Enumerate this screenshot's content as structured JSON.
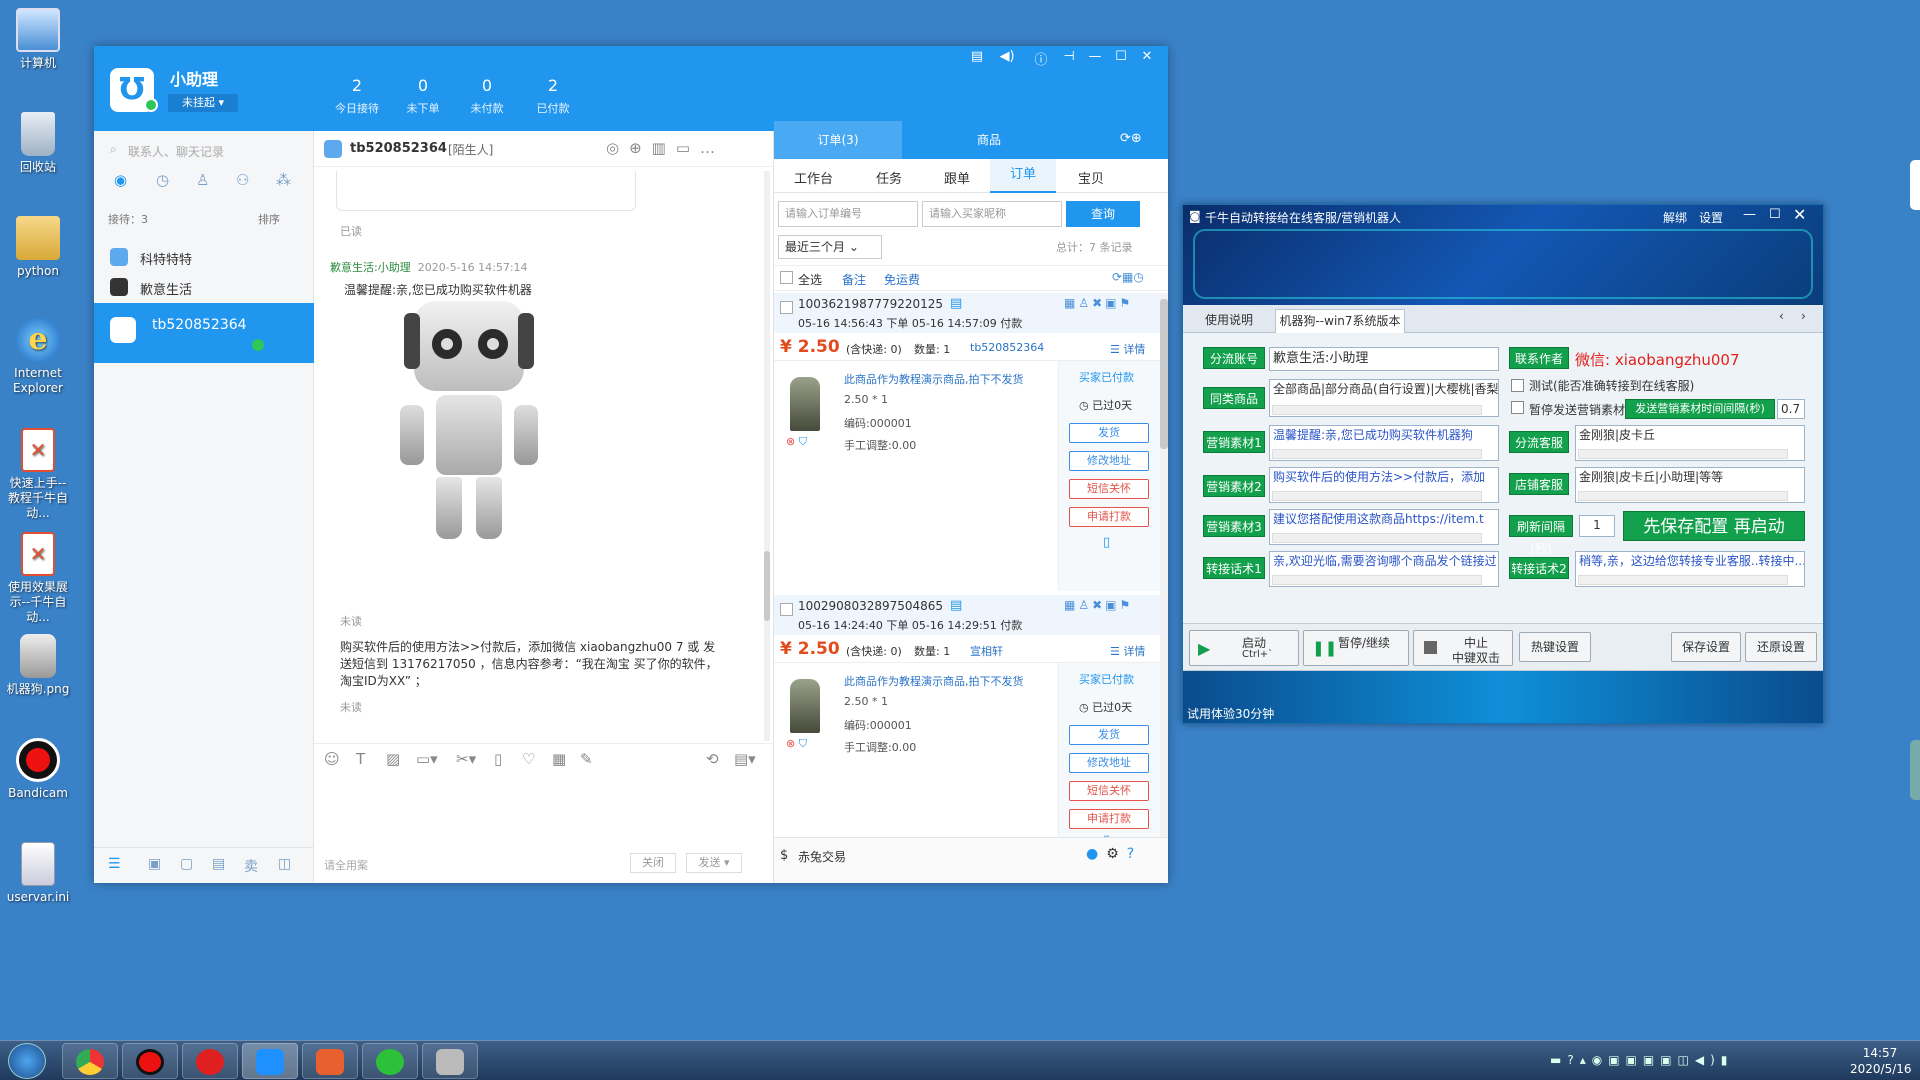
{
  "desktop": {
    "icons": [
      "计算机",
      "回收站",
      "python",
      "Internet Explorer",
      "快速上手--教程千牛自动...",
      "使用效果展示--千牛自动...",
      "机器狗.png",
      "Bandicam",
      "uservar.ini"
    ]
  },
  "taskbar": {
    "time": "14:57",
    "date": "2020/5/16",
    "apps": [
      "start-orb",
      "chrome",
      "bandicam",
      "netease-music",
      "qianniu",
      "wps",
      "wechat",
      "robot"
    ]
  },
  "qianniu": {
    "user": {
      "name": "小助理",
      "status": "未挂起 ▾"
    },
    "stats": [
      {
        "value": "2",
        "label": "今日接待"
      },
      {
        "value": "0",
        "label": "未下单"
      },
      {
        "value": "0",
        "label": "未付款"
      },
      {
        "value": "2",
        "label": "已付款"
      }
    ],
    "search_placeholder": "联系人、聊天记录",
    "reception_count": "接待：3",
    "sort_label": "排序",
    "contacts": [
      "科特特特",
      "歉意生活",
      "tb520852364"
    ],
    "chat": {
      "contact": "tb520852364",
      "contact_tag": "[陌生人]",
      "read_label": "已读",
      "sender": "歉意生活:小助理",
      "timestamp": "2020-5-16 14:57:14",
      "message1": "温馨提醒:亲,您已成功购买软件机器",
      "unread_label": "未读",
      "message2": "购买软件后的使用方法>>付款后，添加微信 xiaobangzhu00 7 或 发送短信到 13176217050 ，信息内容参考：“我在淘宝 买了你的软件，淘宝ID为XX” ；",
      "unread_label2": "未读",
      "quick_phrase": "请全用案",
      "close_btn": "关闭",
      "send_btn": "发送"
    },
    "right": {
      "top_tabs": [
        "订单(3)",
        "商品"
      ],
      "sub_tabs": [
        "工作台",
        "任务",
        "跟单",
        "订单",
        "宝贝"
      ],
      "order_no_placeholder": "请输入订单编号",
      "buyer_placeholder": "请输入买家昵称",
      "query_btn": "查询",
      "range": "最近三个月",
      "total": "总计：7 条记录",
      "select_all": "全选",
      "remark": "备注",
      "free_ship": "免运费",
      "orders": [
        {
          "id": "1003621987779220125",
          "times": "05-16 14:56:43 下单   05-16 14:57:09 付款",
          "price": "¥ 2.50",
          "ship": "(含快递: 0)",
          "qty": "数量: 1",
          "buyer": "tb520852364",
          "detail": "详情",
          "item": "此商品作为教程演示商品,拍下不发货",
          "unit": "2.50 * 1",
          "code": "编码:000001",
          "adjust": "手工调整:0.00",
          "state": "买家已付款",
          "elapsed": "已过0天",
          "btns": [
            "发货",
            "修改地址",
            "短信关怀",
            "申请打款"
          ]
        },
        {
          "id": "1002908032897504865",
          "times": "05-16 14:24:40 下单   05-16 14:29:51 付款",
          "price": "¥ 2.50",
          "ship": "(含快递: 0)",
          "qty": "数量: 1",
          "buyer": "宣相轩",
          "detail": "详情",
          "item": "此商品作为教程演示商品,拍下不发货",
          "unit": "2.50 * 1",
          "code": "编码:000001",
          "adjust": "手工调整:0.00",
          "state": "买家已付款",
          "elapsed": "已过0天",
          "btns": [
            "发货",
            "修改地址",
            "短信关怀",
            "申请打款"
          ]
        }
      ],
      "footer": "赤兔交易"
    }
  },
  "robot": {
    "title": "千牛自动转接给在线客服/营销机器人",
    "title_links": [
      "解绑",
      "设置"
    ],
    "tabs": [
      "使用说明",
      "机器狗--win7系统版本"
    ],
    "fields": {
      "shunt_account_label": "分流账号",
      "shunt_account": "歉意生活:小助理",
      "contact_author_label": "联系作者",
      "contact_author": "微信: xiaobangzhu007",
      "same_goods_label": "同类商品",
      "same_goods": "全部商品|部分商品(自行设置)|大樱桃|香梨",
      "test_checkbox": "测试(能否准确转接到在线客服)",
      "pause_checkbox": "暂停发送营销素材",
      "interval_label": "发送营销素材时间间隔(秒)",
      "interval_value": "0.7",
      "mat1_label": "营销素材1",
      "mat1": "温馨提醒:亲,您已成功购买软件机器狗",
      "mat2_label": "营销素材2",
      "mat2": "购买软件后的使用方法>>付款后，添加",
      "mat3_label": "营销素材3",
      "mat3": "建议您搭配使用这款商品https://item.t",
      "cs_label": "分流客服",
      "cs": "金刚狼|皮卡丘",
      "shop_cs_label": "店铺客服",
      "shop_cs": "金刚狼|皮卡丘|小助理|等等",
      "refresh_label": "刷新间隔(秒)",
      "refresh_value": "1",
      "save_start": "先保存配置 再启动",
      "talk1_label": "转接话术1",
      "talk1": "亲,欢迎光临,需要咨询哪个商品发个链接过",
      "talk2_label": "转接话术2",
      "talk2": "稍等,亲，这边给您转接专业客服..转接中..."
    },
    "buttons": {
      "start": "启动",
      "start_hint": "Ctrl+`",
      "pause": "暂停/继续",
      "stop": "中止",
      "stop_hint": "中键双击",
      "hotkey": "热键设置",
      "save": "保存设置",
      "restore": "还原设置"
    },
    "trial": "试用体验30分钟"
  },
  "colors": {
    "qn_blue": "#2196ef",
    "robot_green": "#13a04c",
    "price_red": "#e34a1c"
  }
}
